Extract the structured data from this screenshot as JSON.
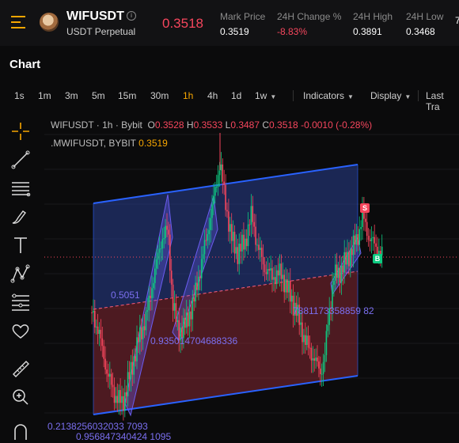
{
  "header": {
    "symbol": "WIFUSDT",
    "subtitle": "USDT Perpetual",
    "last_price": "0.3518",
    "stats": [
      {
        "label": "Mark Price",
        "value": "0.3519"
      },
      {
        "label": "24H Change %",
        "value": "-8.83%"
      },
      {
        "label": "24H High",
        "value": "0.3891"
      },
      {
        "label": "24H Low",
        "value": "0.3468"
      },
      {
        "label": "",
        "value": "7"
      }
    ]
  },
  "section": {
    "title": "Chart"
  },
  "timeframes": [
    "1s",
    "1m",
    "3m",
    "5m",
    "15m",
    "30m",
    "1h",
    "4h",
    "1d",
    "1w"
  ],
  "active_timeframe": "1h",
  "toolbar": {
    "indicators": "Indicators",
    "display": "Display",
    "last_traded": "Last Tra"
  },
  "legend": {
    "symbol": "WIFUSDT",
    "interval": "1h",
    "exchange": "Bybit",
    "o_label": "O",
    "o": "0.3528",
    "h_label": "H",
    "h": "0.3533",
    "l_label": "L",
    "l": "0.3487",
    "c_label": "C",
    "c": "0.3518",
    "change": "-0.0010 (-0.28%)",
    "indicator_name": ".MWIFUSDT, BYBIT",
    "indicator_value": "0.3519"
  },
  "fib_labels": [
    "0.5051",
    "0.935014704688336",
    "7881173358859 82",
    "0.2138256032033 7093",
    "0.956847340424 1095"
  ],
  "signals": [
    "S",
    "B"
  ],
  "colors": {
    "up": "#0ecb81",
    "down": "#f6465d",
    "accent": "#f7a600",
    "channel": "#2962ff",
    "fib": "#7b6ff0"
  }
}
